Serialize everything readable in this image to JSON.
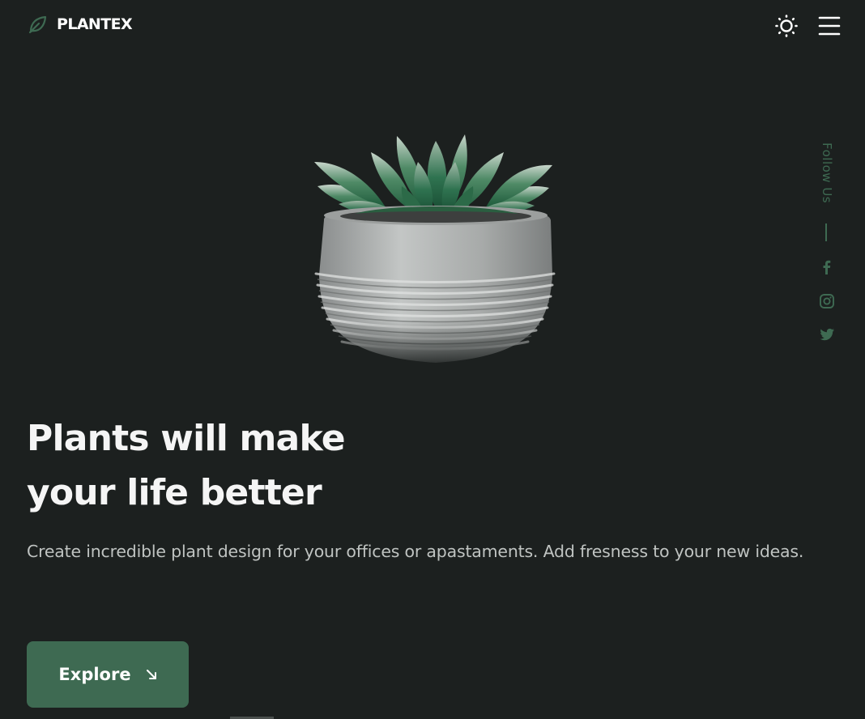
{
  "header": {
    "logo_text": "PLANTEX",
    "logo_icon": "leaf-icon",
    "theme_icon": "sun-icon",
    "menu_icon": "hamburger-menu-icon"
  },
  "hero": {
    "title_line1": "Plants will make",
    "title_line2": "your life better",
    "description": "Create incredible plant design for your offices or apastaments. Add fresness to your new ideas.",
    "cta_label": "Explore",
    "cta_icon": "arrow-down-right-icon",
    "image": "potted-succulent-image"
  },
  "social": {
    "label": "Follow Us",
    "icons": [
      "facebook-icon",
      "instagram-icon",
      "twitter-icon"
    ]
  },
  "colors": {
    "background": "#1c201f",
    "accent": "#3e6a52",
    "text": "#f5f5f5",
    "muted_text": "#bfc3c1"
  }
}
